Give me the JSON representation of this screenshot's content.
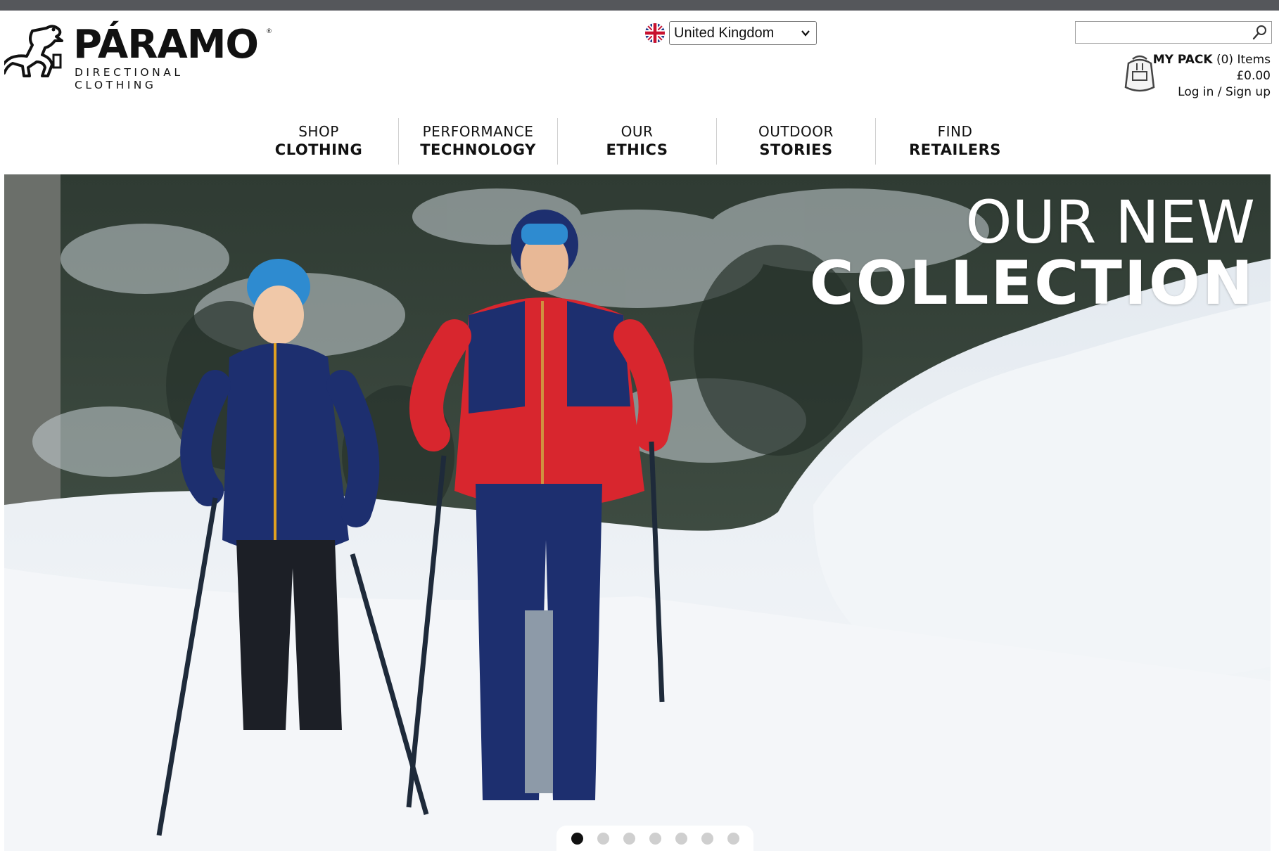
{
  "brand": {
    "name": "PÁRAMO",
    "tagline": "DIRECTIONAL CLOTHING",
    "registered_mark": "®"
  },
  "country_selector": {
    "selected": "United Kingdom",
    "flag_icon": "uk-flag-icon"
  },
  "search": {
    "placeholder": "",
    "value": "",
    "icon": "search-icon"
  },
  "pack": {
    "title": "MY PACK",
    "count_text": "(0) Items",
    "total": "£0.00",
    "login_label": "Log in / Sign up",
    "icon": "backpack-icon"
  },
  "nav": {
    "items": [
      {
        "top": "SHOP",
        "bottom": "CLOTHING"
      },
      {
        "top": "PERFORMANCE",
        "bottom": "TECHNOLOGY"
      },
      {
        "top": "OUR",
        "bottom": "ETHICS"
      },
      {
        "top": "OUTDOOR",
        "bottom": "STORIES"
      },
      {
        "top": "FIND",
        "bottom": "RETAILERS"
      }
    ]
  },
  "hero": {
    "line1": "OUR NEW",
    "line2": "COLLECTION",
    "slide_count": 7,
    "active_slide": 1
  },
  "colors": {
    "top_bar": "#55575b",
    "jacket_red": "#d8262e",
    "jacket_navy": "#1d2f6f",
    "hat_blue": "#2e8bd0",
    "snow": "#eef2f6"
  }
}
